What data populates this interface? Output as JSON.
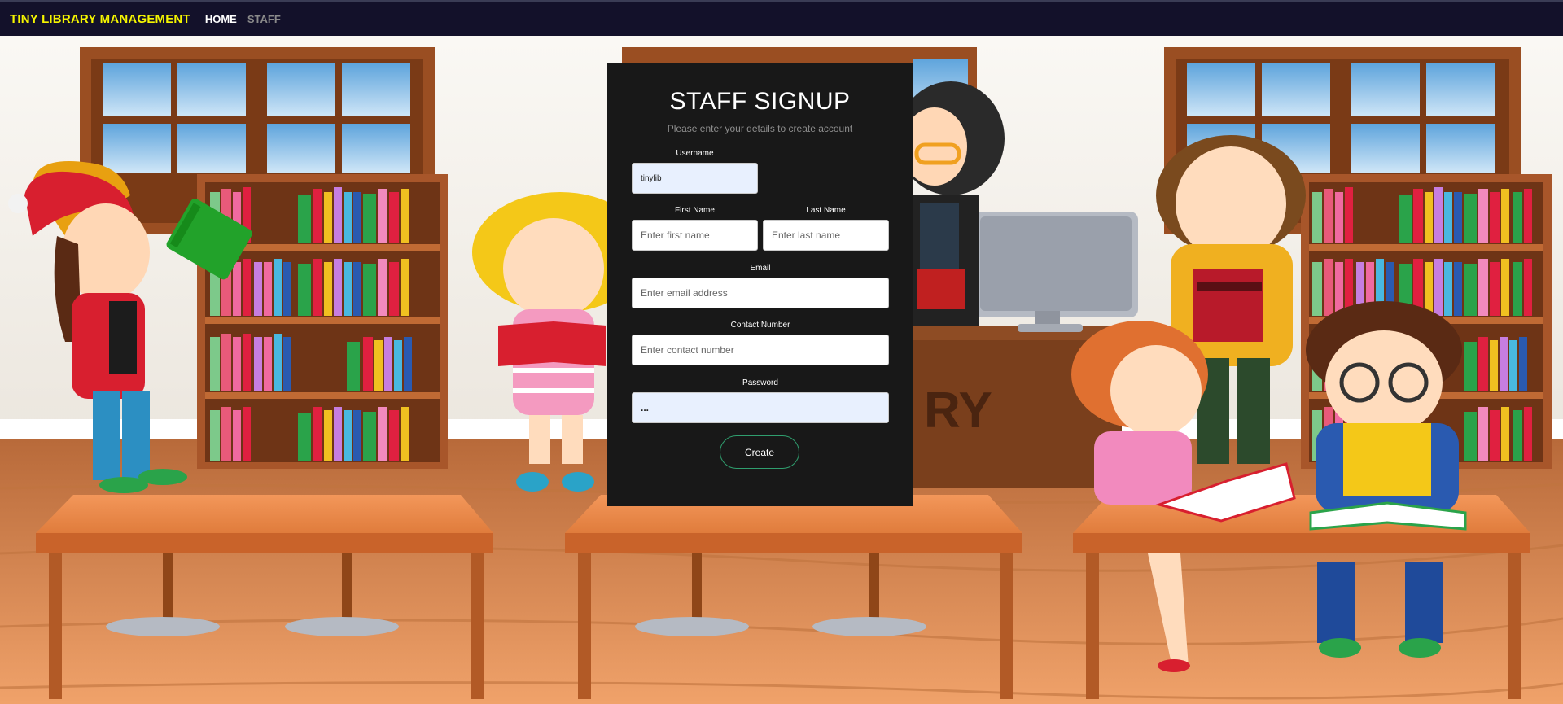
{
  "navbar": {
    "brand": "TINY LIBRARY MANAGEMENT",
    "links": [
      {
        "label": "HOME",
        "active": true
      },
      {
        "label": "STAFF",
        "active": false
      }
    ]
  },
  "form": {
    "title": "STAFF SIGNUP",
    "subtitle": "Please enter your details to create account",
    "username": {
      "label": "Username",
      "value": "tinylib"
    },
    "first_name": {
      "label": "First Name",
      "placeholder": "Enter first name"
    },
    "last_name": {
      "label": "Last Name",
      "placeholder": "Enter last name"
    },
    "email": {
      "label": "Email",
      "placeholder": "Enter email address"
    },
    "contact": {
      "label": "Contact Number",
      "placeholder": "Enter contact number"
    },
    "password": {
      "label": "Password",
      "value": "..."
    },
    "submit_label": "Create"
  },
  "background": {
    "sign_text": "RY"
  },
  "colors": {
    "navbar_bg": "#13112a",
    "brand": "#f5f500",
    "card_bg": "#181818",
    "button_border": "#2f9e6e",
    "autofill_bg": "#e8f0fe"
  }
}
